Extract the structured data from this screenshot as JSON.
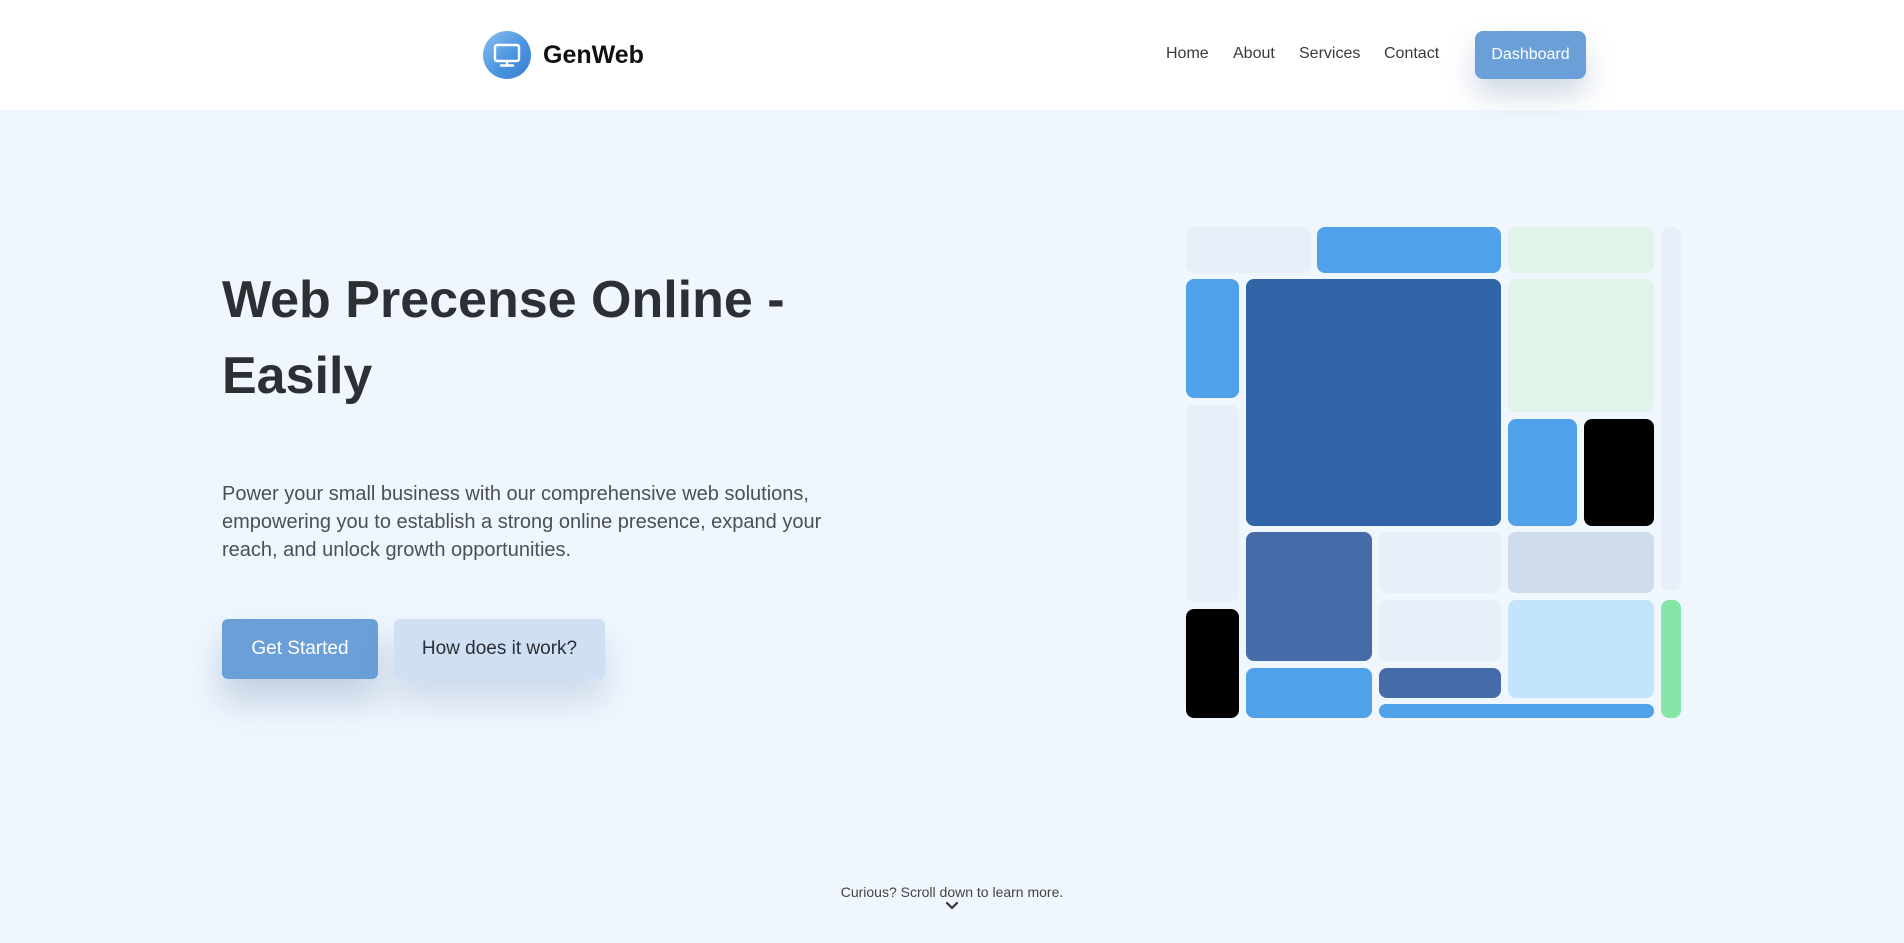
{
  "header": {
    "brand_name": "GenWeb",
    "logo_icon": "monitor-icon",
    "nav": [
      "Home",
      "About",
      "Services",
      "Contact"
    ],
    "dashboard_label": "Dashboard"
  },
  "hero": {
    "title": "Web Precense Online - Easily",
    "description": "Power your small business with our comprehensive web solutions, empowering you to establish a strong online presence, expand your reach, and unlock growth opportunities.",
    "primary_cta": "Get Started",
    "secondary_cta": "How does it work?"
  },
  "footer_hint": {
    "text": "Curious? Scroll down to learn more.",
    "icon": "chevron-down-icon"
  },
  "colors": {
    "accent": "#6a9fd8",
    "background": "#eff6fe",
    "tile_light": "#e8eff9",
    "tile_blue": "#4fa1ea",
    "tile_dark_blue": "#3165a8",
    "tile_mid_blue": "#456ba8",
    "tile_mint": "#e0f4ea",
    "tile_pale_blue": "#c4e4fb",
    "tile_steel": "#cfdcec",
    "tile_green": "#86e6a8",
    "tile_black": "#000000"
  }
}
